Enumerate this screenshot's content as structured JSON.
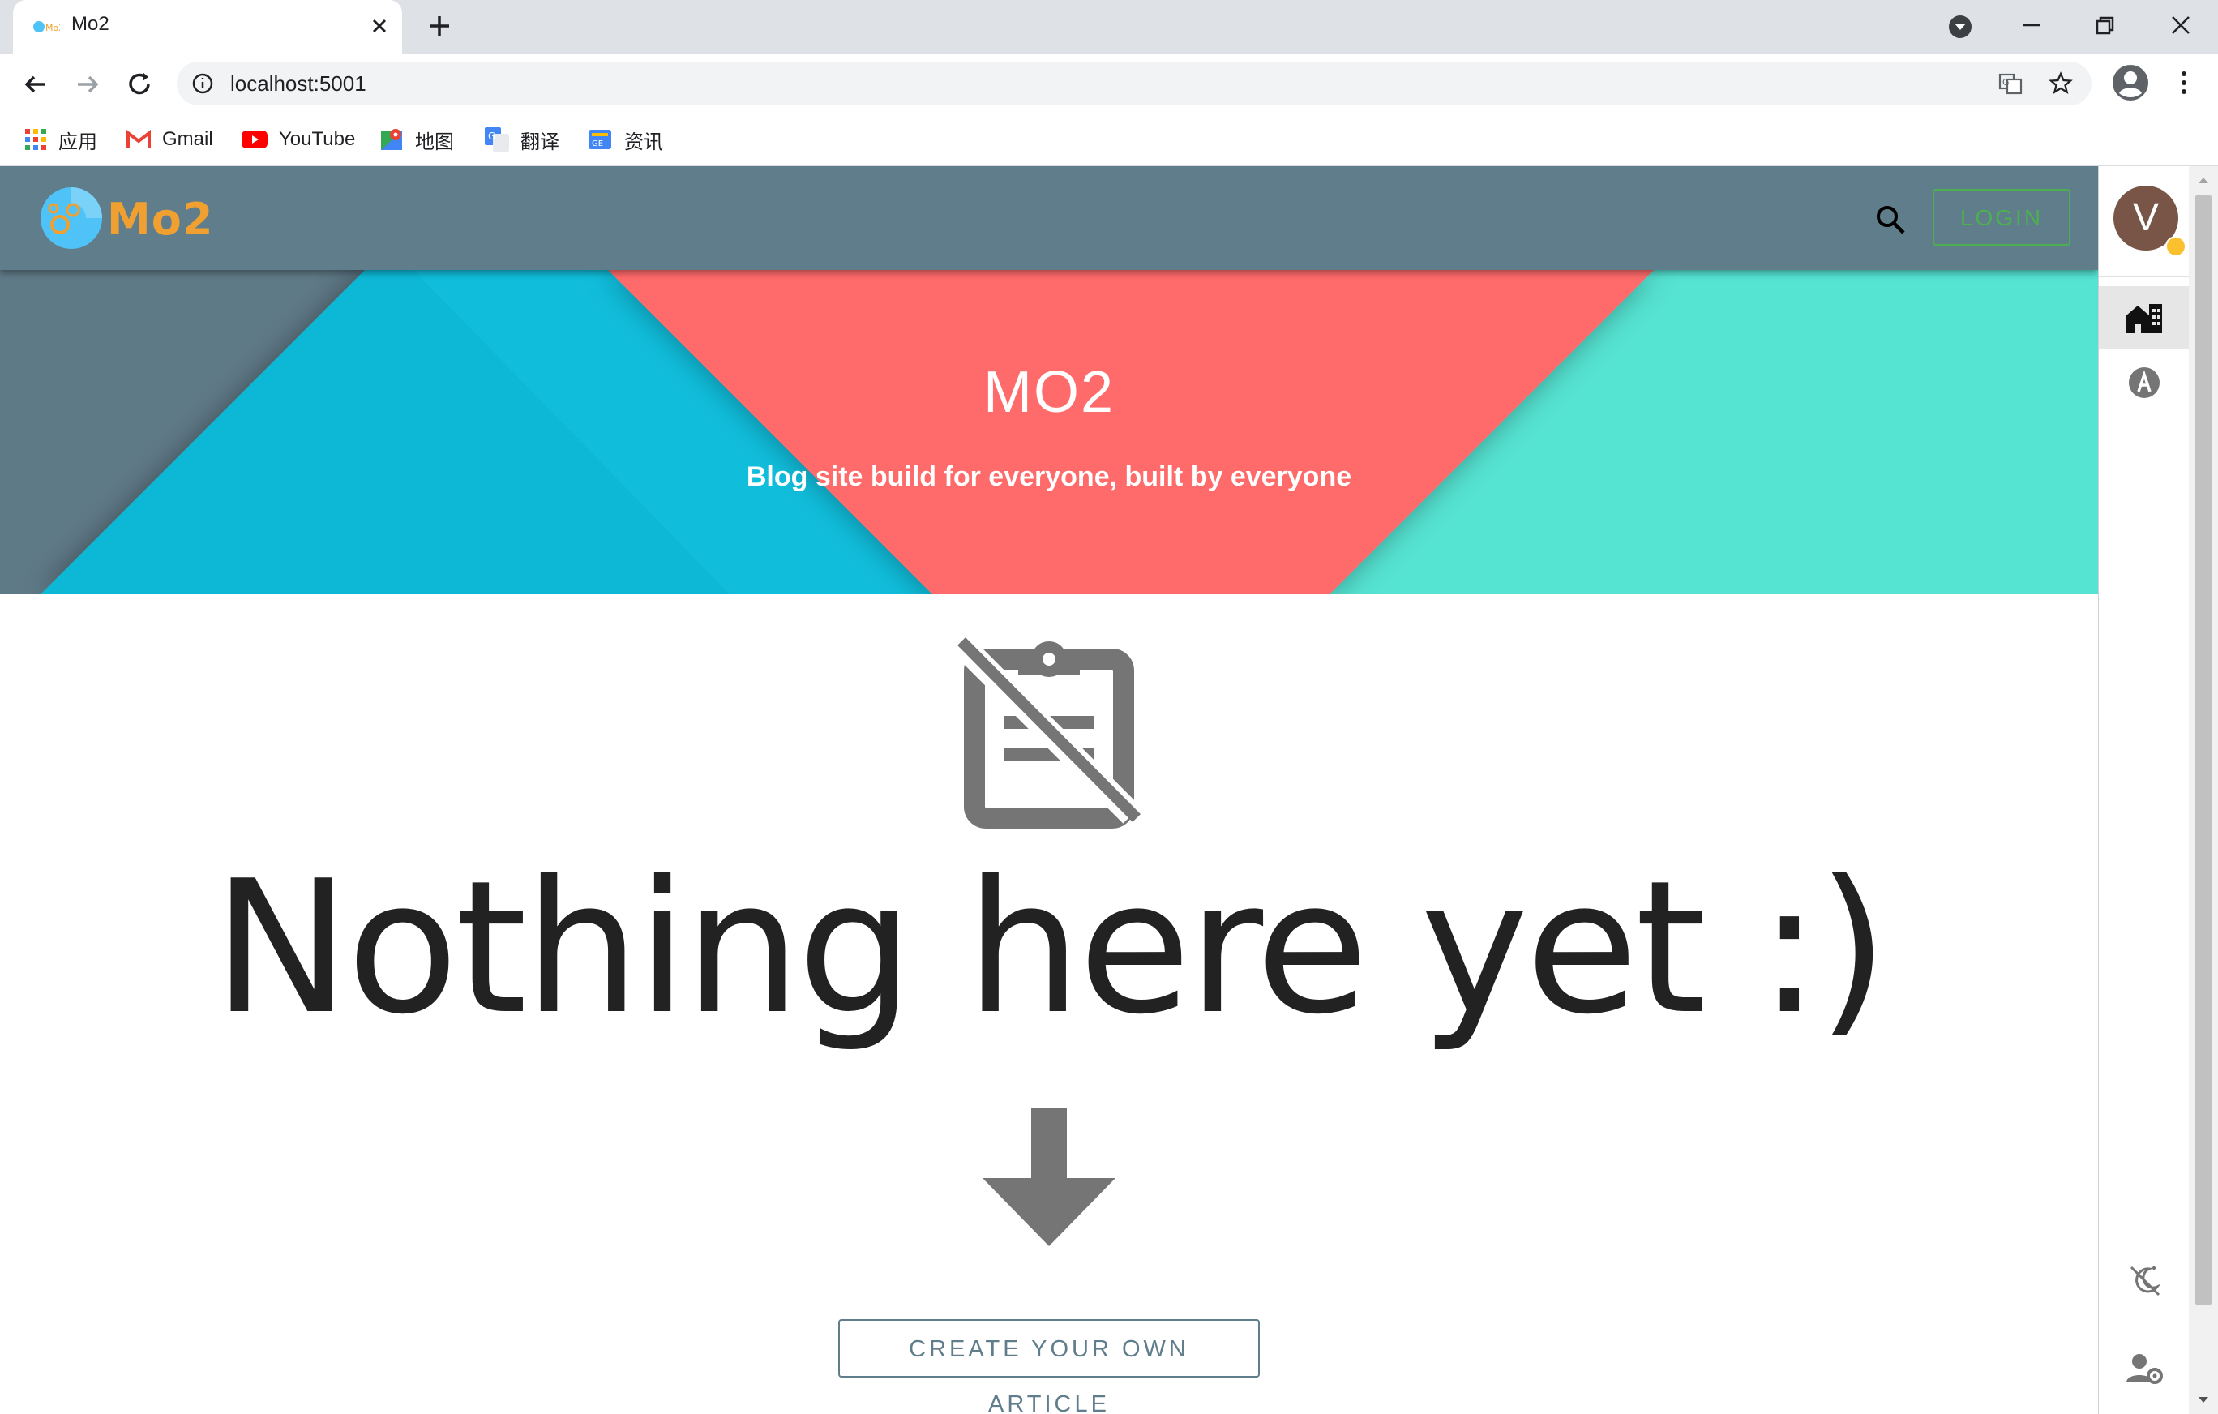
{
  "browser": {
    "tab_title": "Mo2",
    "url": "localhost:5001",
    "bookmarks": [
      {
        "label": "应用",
        "icon": "apps-grid-icon"
      },
      {
        "label": "Gmail",
        "icon": "gmail-icon"
      },
      {
        "label": "YouTube",
        "icon": "youtube-icon"
      },
      {
        "label": "地图",
        "icon": "maps-icon"
      },
      {
        "label": "翻译",
        "icon": "translate-icon"
      },
      {
        "label": "资讯",
        "icon": "news-icon"
      }
    ]
  },
  "app": {
    "logo_text": "Mo2",
    "login_label": "LOGIN",
    "hero_title": "MO2",
    "hero_subtitle": "Blog site build for everyone, built by everyone",
    "empty_message": "Nothing here yet :)",
    "create_button_label": "CREATE YOUR OWN ARTICLE"
  },
  "drawer": {
    "avatar_letter": "V",
    "items": [
      {
        "icon": "home-buildings-icon",
        "active": true
      },
      {
        "icon": "letter-a-circle-icon",
        "active": false
      },
      {
        "icon": "theme-toggle-icon",
        "active": false
      },
      {
        "icon": "user-settings-icon",
        "active": false
      }
    ]
  },
  "colors": {
    "appbar": "#607d8b",
    "accent_green": "#4caf50",
    "hero_blue": "#0fb8d6",
    "hero_red": "#ff6b6b",
    "hero_teal": "#55e3d2",
    "logo_orange": "#f0a030",
    "avatar_brown": "#795548"
  }
}
